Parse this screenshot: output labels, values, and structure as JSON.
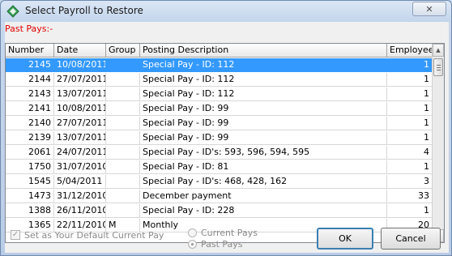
{
  "window": {
    "title": "Select Payroll to Restore",
    "close_glyph": "✕"
  },
  "section_label": "Past Pays:-",
  "columns": [
    "Number",
    "Date",
    "Group",
    "Posting Description",
    "Employees"
  ],
  "rows": [
    {
      "number": "2145",
      "date": "10/08/2011",
      "group": "",
      "description": "Special Pay - ID: 112",
      "employees": "1",
      "selected": true
    },
    {
      "number": "2144",
      "date": "27/07/2011",
      "group": "",
      "description": "Special Pay - ID: 112",
      "employees": "1"
    },
    {
      "number": "2143",
      "date": "13/07/2011",
      "group": "",
      "description": "Special Pay - ID: 112",
      "employees": "1"
    },
    {
      "number": "2141",
      "date": "10/08/2011",
      "group": "",
      "description": "Special Pay - ID: 99",
      "employees": "1"
    },
    {
      "number": "2140",
      "date": "27/07/2011",
      "group": "",
      "description": "Special Pay - ID: 99",
      "employees": "1"
    },
    {
      "number": "2139",
      "date": "13/07/2011",
      "group": "",
      "description": "Special Pay - ID: 99",
      "employees": "1"
    },
    {
      "number": "2061",
      "date": "24/07/2011",
      "group": "",
      "description": "Special Pay - ID's: 593, 596, 594, 595",
      "employees": "4"
    },
    {
      "number": "1750",
      "date": "31/07/2010",
      "group": "",
      "description": "Special Pay - ID: 81",
      "employees": "1"
    },
    {
      "number": "1545",
      "date": "5/04/2011",
      "group": "",
      "description": "Special Pay - ID's: 468, 428, 162",
      "employees": "3"
    },
    {
      "number": "1473",
      "date": "31/12/2010",
      "group": "",
      "description": "December payment",
      "employees": "33"
    },
    {
      "number": "1388",
      "date": "26/11/2010",
      "group": "",
      "description": "Special Pay - ID: 228",
      "employees": "1"
    },
    {
      "number": "1365",
      "date": "22/11/2010",
      "group": "M",
      "description": "Monthly",
      "employees": "20"
    }
  ],
  "options": {
    "default_checkbox_label": "Set as Your Default Current Pay",
    "default_checked": true,
    "radio_current": "Current Pays",
    "radio_past": "Past Pays",
    "selected_radio": "past"
  },
  "buttons": {
    "ok": "OK",
    "cancel": "Cancel"
  },
  "icons": {
    "app": "diamond-app-icon",
    "scroll_up": "▲",
    "scroll_down": "▼",
    "check": "✓"
  }
}
